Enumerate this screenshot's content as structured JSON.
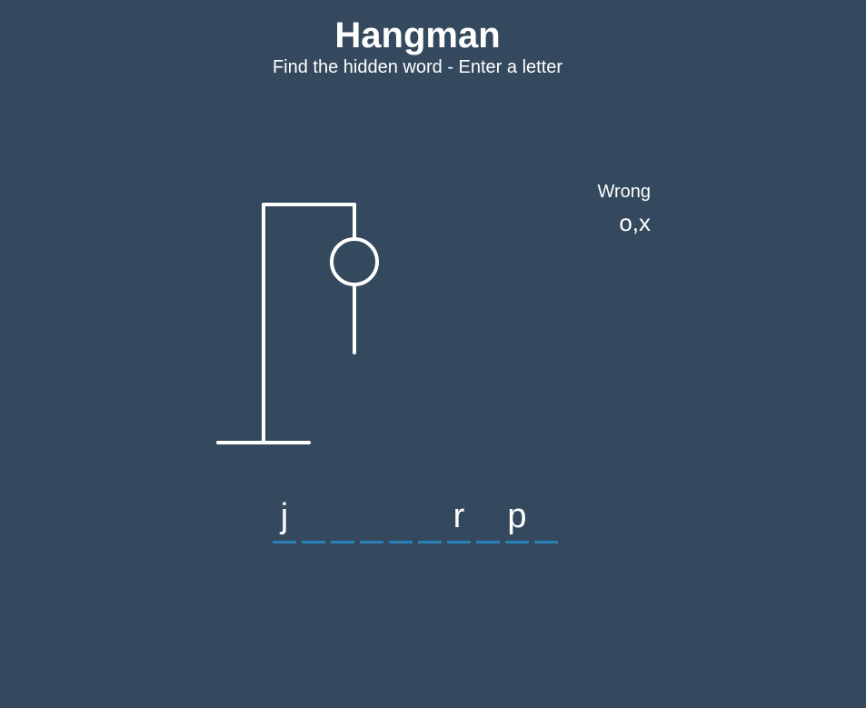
{
  "header": {
    "title": "Hangman",
    "subtitle": "Find the hidden word - Enter a letter"
  },
  "wrong": {
    "label": "Wrong",
    "letters": "o,x"
  },
  "word": {
    "letters": [
      "j",
      "",
      "",
      "",
      "",
      "",
      "r",
      "",
      "p",
      ""
    ]
  },
  "hangman": {
    "parts_shown": [
      "base",
      "pole",
      "beam",
      "rope",
      "head",
      "body"
    ]
  },
  "colors": {
    "background": "#34495e",
    "text": "#ffffff",
    "underline": "#2980b9"
  }
}
